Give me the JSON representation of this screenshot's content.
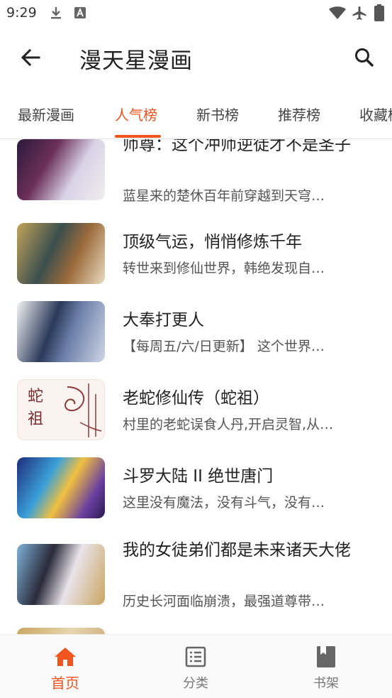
{
  "status_bar": {
    "time": "9:29"
  },
  "app_bar": {
    "title": "漫天星漫画"
  },
  "tabs": [
    {
      "label": "最新漫画"
    },
    {
      "label": "人气榜"
    },
    {
      "label": "新书榜"
    },
    {
      "label": "推荐榜"
    },
    {
      "label": "收藏榜"
    }
  ],
  "comics": [
    {
      "title": "师尊：这个冲师逆徒才不是圣子",
      "desc": "蓝星来的楚休百年前穿越到天穹…"
    },
    {
      "title": "顶级气运，悄悄修炼千年",
      "desc": "转世来到修仙世界，韩绝发现自…"
    },
    {
      "title": "大奉打更人",
      "desc": "【每周五/六/日更新】 这个世界…"
    },
    {
      "title": "老蛇修仙传（蛇祖）",
      "desc": "村里的老蛇误食人丹,开启灵智,从…",
      "cover_text": "蛇祖"
    },
    {
      "title": "斗罗大陆 II 绝世唐门",
      "desc": "这里没有魔法，没有斗气，没有…"
    },
    {
      "title": "我的女徒弟们都是未来诸天大佬",
      "desc": "历史长河面临崩溃，最强道尊带…"
    }
  ],
  "bottom_nav": [
    {
      "label": "首页"
    },
    {
      "label": "分类"
    },
    {
      "label": "书架"
    }
  ],
  "colors": {
    "accent": "#f0541f"
  }
}
